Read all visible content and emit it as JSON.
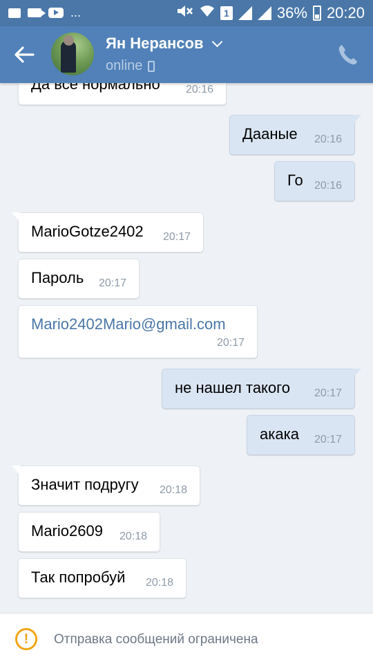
{
  "status_bar": {
    "dots": "...",
    "battery": "36%",
    "time": "20:20",
    "sim_label": "1"
  },
  "header": {
    "contact_name": "Ян Нерансов",
    "status": "online"
  },
  "messages": [
    {
      "direction": "in",
      "text": "Да все нормально",
      "time": "20:16"
    },
    {
      "direction": "out",
      "text": "Дааные",
      "time": "20:16"
    },
    {
      "direction": "out",
      "text": "Го",
      "time": "20:16"
    },
    {
      "direction": "in",
      "text": "MarioGotze2402",
      "time": "20:17"
    },
    {
      "direction": "in",
      "text": "Пароль",
      "time": "20:17"
    },
    {
      "direction": "in",
      "text": "Mario2402Mario@gmail.com",
      "time": "20:17",
      "is_link": true
    },
    {
      "direction": "out",
      "text": "не нашел такого",
      "time": "20:17"
    },
    {
      "direction": "out",
      "text": "акака",
      "time": "20:17"
    },
    {
      "direction": "in",
      "text": "Значит подругу",
      "time": "20:18"
    },
    {
      "direction": "in",
      "text": "Mario2609",
      "time": "20:18"
    },
    {
      "direction": "in",
      "text": "Так попробуй",
      "time": "20:18"
    }
  ],
  "footer": {
    "notice": "Отправка сообщений ограничена"
  },
  "colors": {
    "header": "#5181b8",
    "status_bar": "#4a77a8",
    "incoming_bubble": "#ffffff",
    "outgoing_bubble": "#dae5f3",
    "link": "#4a76a8",
    "warning": "#f2a516"
  }
}
